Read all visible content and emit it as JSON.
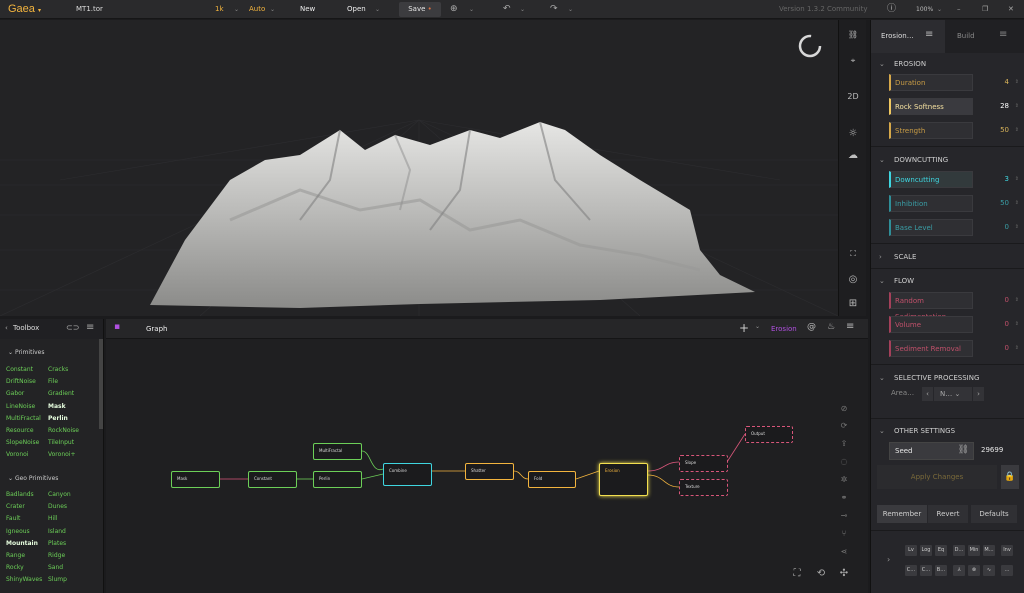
{
  "app": {
    "logo": "Gaea",
    "file": "MT1.tor",
    "resolution": "1k",
    "mode": "Auto",
    "new": "New",
    "open": "Open",
    "save": "Save",
    "version": "Version 1.3.2 Community",
    "zoom": "100%"
  },
  "viewport": {
    "view_label": "2D"
  },
  "properties": {
    "tab_active": "Erosion…",
    "tab_build": "Build",
    "sections": {
      "erosion": "EROSION",
      "downcutting": "DOWNCUTTING",
      "scale": "SCALE",
      "flow": "FLOW",
      "selective": "SELECTIVE PROCESSING",
      "other": "OTHER SETTINGS"
    },
    "erosion": [
      {
        "label": "Duration",
        "value": "4"
      },
      {
        "label": "Rock Softness",
        "value": "28"
      },
      {
        "label": "Strength",
        "value": "50"
      }
    ],
    "downcutting": [
      {
        "label": "Downcutting",
        "value": "3"
      },
      {
        "label": "Inhibition",
        "value": "50"
      },
      {
        "label": "Base Level",
        "value": "0"
      }
    ],
    "flow": [
      {
        "label": "Random Sedimentation",
        "value": "0"
      },
      {
        "label": "Volume",
        "value": "0"
      },
      {
        "label": "Sediment Removal",
        "value": "0"
      }
    ],
    "selective": {
      "area_label": "Area…",
      "area_value": "N…"
    },
    "seed": {
      "label": "Seed",
      "value": "29699"
    },
    "apply": "Apply Changes",
    "remember": "Remember",
    "revert": "Revert",
    "defaults": "Defaults",
    "footer_row1": [
      "Lv",
      "Log",
      "Eq",
      "D…",
      "Min",
      "M…",
      "Inv"
    ],
    "footer_row2": [
      "C…",
      "C…",
      "B…",
      "⅄",
      "⊗",
      "∿",
      "…"
    ]
  },
  "toolbox": {
    "title": "Toolbox",
    "primitives_label": "Primitives",
    "primitives": [
      [
        "Constant",
        "Cracks"
      ],
      [
        "DriftNoise",
        "File"
      ],
      [
        "Gabor",
        "Gradient"
      ],
      [
        "LineNoise",
        "Mask"
      ],
      [
        "MultiFractal",
        "Perlin"
      ],
      [
        "Resource",
        "RockNoise"
      ],
      [
        "SlopeNoise",
        "TileInput"
      ],
      [
        "Voronoi",
        "Voronoi+"
      ]
    ],
    "geo_label": "Geo Primitives",
    "geo": [
      [
        "Badlands",
        "Canyon"
      ],
      [
        "Crater",
        "Dunes"
      ],
      [
        "Fault",
        "Hill"
      ],
      [
        "Igneous",
        "Island"
      ],
      [
        "Mountain",
        "Plates"
      ],
      [
        "Range",
        "Ridge"
      ],
      [
        "Rocky",
        "Sand"
      ],
      [
        "ShinyWaves",
        "Slump"
      ]
    ]
  },
  "graph": {
    "tab": "Graph",
    "active_node": "Erosion",
    "nodes": {
      "mask": "Mask",
      "constant": "Constant",
      "multifractal": "MultiFractal",
      "perlin": "Perlin",
      "combine": "Combine",
      "shatter": "Shatter",
      "fold": "Fold",
      "erosion": "Erosion",
      "slope": "Slope",
      "texture": "Texture",
      "output": "Output"
    }
  },
  "colors": {
    "accent": "#f3b43e",
    "cyan": "#3fd6e0",
    "green": "#6ccf58",
    "pink": "#d8567a"
  }
}
